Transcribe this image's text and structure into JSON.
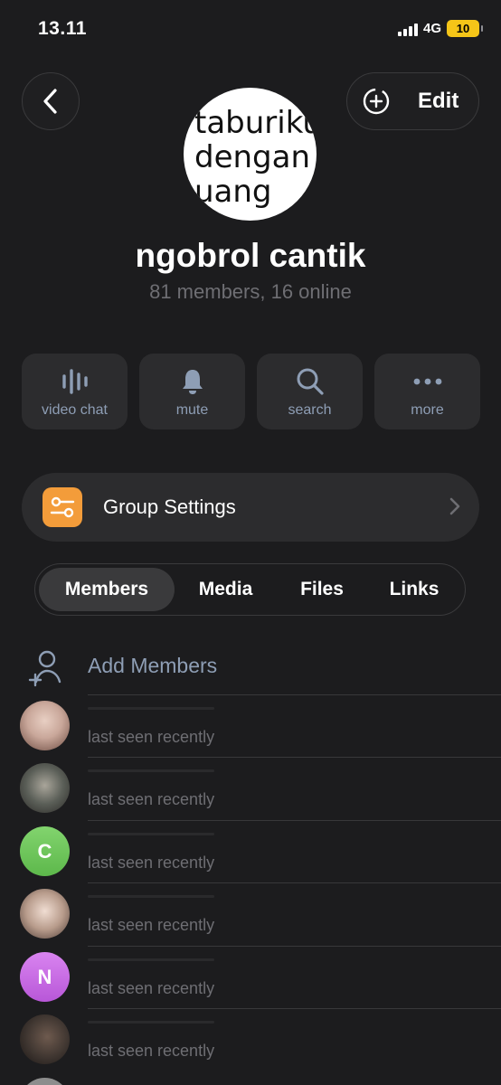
{
  "status": {
    "time": "13.11",
    "network": "4G",
    "battery": "10"
  },
  "header": {
    "edit_label": "Edit"
  },
  "avatar_text": [
    "taburiku",
    "dengan",
    "uang"
  ],
  "group": {
    "name": "ngobrol cantik",
    "subtitle": "81 members, 16 online"
  },
  "actions": [
    {
      "label": "video chat",
      "icon": "voice-wave-icon"
    },
    {
      "label": "mute",
      "icon": "bell-icon"
    },
    {
      "label": "search",
      "icon": "search-icon"
    },
    {
      "label": "more",
      "icon": "more-dots-icon"
    }
  ],
  "settings": {
    "label": "Group Settings",
    "icon_color": "#f39c3a"
  },
  "tabs": [
    "Members",
    "Media",
    "Files",
    "Links"
  ],
  "add_members_label": "Add Members",
  "members": [
    {
      "initial": "",
      "status": "last seen recently",
      "avatar_color": "#c9a79a"
    },
    {
      "initial": "",
      "status": "last seen recently",
      "avatar_color": "#5b5f58"
    },
    {
      "initial": "C",
      "status": "last seen recently",
      "avatar_color": "#6cc15a"
    },
    {
      "initial": "",
      "status": "last seen recently",
      "avatar_color": "#b89c8c"
    },
    {
      "initial": "N",
      "status": "last seen recently",
      "avatar_color": "#c86be3"
    },
    {
      "initial": "",
      "status": "last seen recently",
      "avatar_color": "#3e3530"
    }
  ],
  "colors": {
    "background": "#1c1c1e",
    "card": "#2c2c2e",
    "accent_text": "#8e9eb5",
    "muted_text": "#6e6e73"
  }
}
